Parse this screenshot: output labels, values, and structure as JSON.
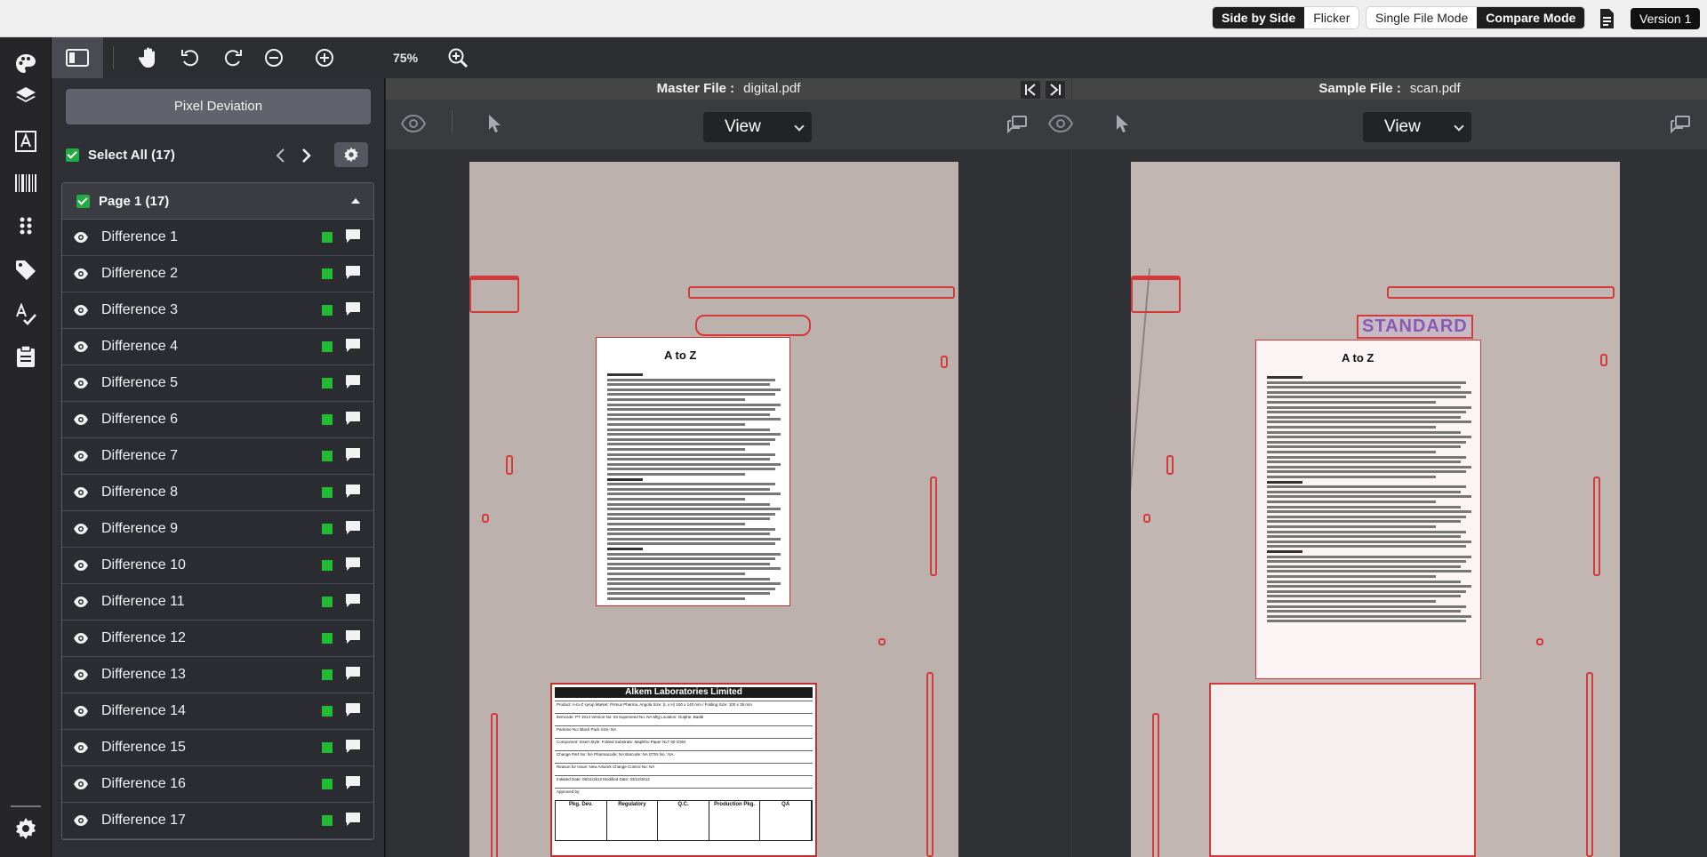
{
  "topbar": {
    "view_modes": [
      "Side by Side",
      "Flicker"
    ],
    "active_view_mode": "Side by Side",
    "file_modes": [
      "Single File Mode",
      "Compare Mode"
    ],
    "active_file_mode": "Compare Mode",
    "file_icon": "document-icon",
    "version_label": "Version 1"
  },
  "rail": {
    "icons": [
      "palette-icon",
      "layers-icon",
      "text-icon",
      "barcode-icon",
      "grid-dots-icon",
      "tag-icon",
      "spellcheck-icon",
      "clipboard-icon",
      "settings-icon"
    ]
  },
  "toolbar": {
    "icons": [
      "panel-toggle-icon",
      "pan-hand-icon",
      "rotate-left-icon",
      "rotate-right-icon",
      "zoom-out-icon",
      "zoom-in-icon",
      "zoom-fit-icon"
    ],
    "zoom_level": "75%"
  },
  "panel": {
    "pixel_deviation_label": "Pixel Deviation",
    "select_all_label": "Select All (17)",
    "page_label": "Page 1 (17)",
    "differences": [
      "Difference 1",
      "Difference 2",
      "Difference 3",
      "Difference 4",
      "Difference 5",
      "Difference 6",
      "Difference 7",
      "Difference 8",
      "Difference 9",
      "Difference 10",
      "Difference 11",
      "Difference 12",
      "Difference 13",
      "Difference 14",
      "Difference 15",
      "Difference 16",
      "Difference 17"
    ],
    "status_color": "#22bb33"
  },
  "master": {
    "file_label": "Master File :",
    "file_name": "digital.pdf",
    "view_label": "View"
  },
  "sample": {
    "file_label": "Sample File :",
    "file_name": "scan.pdf",
    "view_label": "View"
  },
  "document": {
    "product_title": "A to Z",
    "stamp_text": "STANDARD",
    "company": "Alkem Laboratories Limited",
    "spec_rows": [
      "Product: A-to-Z syrup                    Market: Primus Pharma, Angola                 Size: (L x H) 100 x 140 mm / Folding Size: 100 x 35 mm",
      "Itemcode: PT 1914                  Version No: 03                    Superseed No: NA                    Mfg Location: Gulphe, Baddi",
      "Pantone No: Black                                                                 Pack Size: NA",
      "Component: Insert           Style: Folded           Substrate: Maplitho Paper NLT 60 GSM",
      "Change Part No: NA             Pharmacode: NA          Barcode: NA             GTIN No.: NA",
      "Reason for Issue: New Artwork                                                  Change Control No: NA",
      "Initiated Date: 06/11/2k12                                                       Modified Date: 03/12/2k12",
      "Approved by:"
    ],
    "approval_cols": [
      "Pkg. Dev.",
      "Regulatory",
      "Q.C.",
      "Production Pkg.",
      "QA"
    ]
  }
}
